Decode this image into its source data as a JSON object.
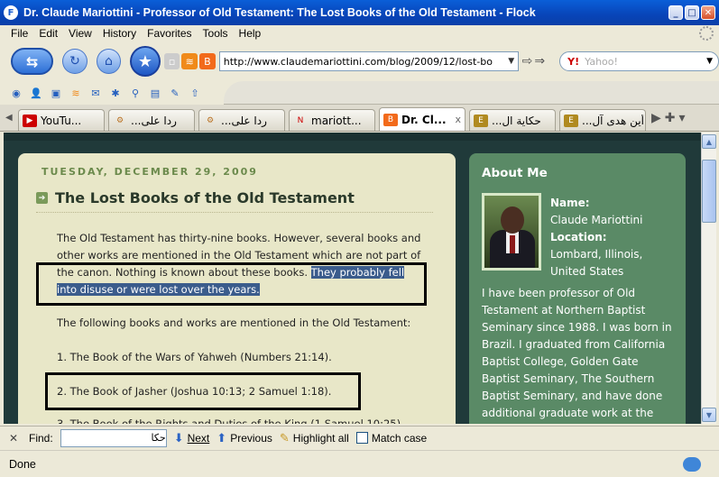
{
  "window": {
    "title": "Dr. Claude Mariottini - Professor of Old Testament: The Lost Books of the Old Testament - Flock",
    "minimize": "_",
    "maximize": "□",
    "close": "✕"
  },
  "menu": [
    "File",
    "Edit",
    "View",
    "History",
    "Favorites",
    "Tools",
    "Help"
  ],
  "nav": {
    "url": "http://www.claudemariottini.com/blog/2009/12/lost-bo",
    "search_placeholder": "Yahoo!",
    "search_engine": "Y!"
  },
  "tabs": [
    {
      "label": "YouTu...",
      "icon": "youtube-icon"
    },
    {
      "label": "...ردا على",
      "icon": "gear-icon"
    },
    {
      "label": "...ردا على",
      "icon": "gear-icon"
    },
    {
      "label": "mariott...",
      "icon": "news-icon"
    },
    {
      "label": "Dr. Cl...",
      "icon": "blogger-icon",
      "active": true
    },
    {
      "label": "...حكاية ال",
      "icon": "e-icon"
    },
    {
      "label": "...أين هدى آل",
      "icon": "e-icon"
    }
  ],
  "post": {
    "date": "TUESDAY, DECEMBER 29, 2009",
    "title": "The Lost Books of the Old Testament",
    "para1_a": "The Old Testament has thirty-nine books. However, several books and other works are mentioned in the Old Testament which are not part of the canon. Nothing is known about these books. ",
    "para1_hl": "They probably fell into disuse or were lost over the years.",
    "para2": "The following books and works are mentioned in the Old Testament:",
    "item1": "1. The Book of the Wars of Yahweh (Numbers 21:14).",
    "item2": "2. The Book of Jasher (Joshua 10:13; 2 Samuel 1:18).",
    "item3": "3. The Book of the Rights and Duties of the King (1 Samuel 10:25)."
  },
  "sidebar": {
    "heading": "About Me",
    "name_label": "Name:",
    "name": "Claude Mariottini",
    "location_label": "Location:",
    "location_line1": "Lombard, Illinois,",
    "location_line2": "United States",
    "bio": "I have been professor of Old Testament at Northern Baptist Seminary since 1988. I was born in Brazil. I graduated from California Baptist College, Golden Gate Baptist Seminary, The Southern Baptist Seminary, and have done additional graduate work at the"
  },
  "findbar": {
    "label": "Find:",
    "value": "حكا",
    "next": "Next",
    "previous": "Previous",
    "highlight": "Highlight all",
    "match_case": "Match case"
  },
  "status": {
    "text": "Done"
  }
}
